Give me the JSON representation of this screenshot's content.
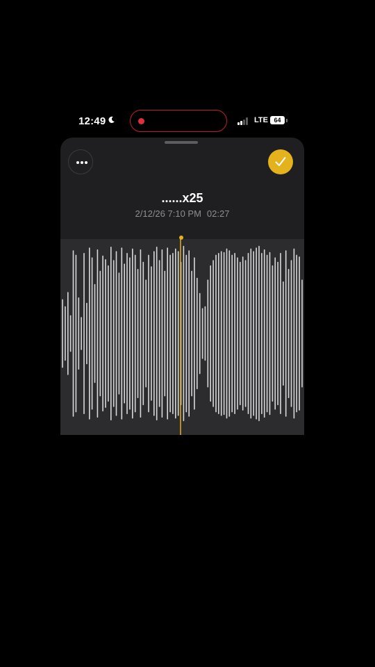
{
  "status_bar": {
    "time": "12:49",
    "network": "LTE",
    "battery": "64",
    "recording_color": "#e0313a"
  },
  "recording": {
    "title": "......x25",
    "date": "2/12/26 7:10 PM",
    "duration": "02:27"
  },
  "colors": {
    "accent": "#e4b21c",
    "sheet_bg": "#1f1f21",
    "waveform_bg": "#2c2c2f",
    "waveform_bars": "#d9d9dc",
    "playhead": "#e4b21c"
  },
  "icons": {
    "more": "ellipsis-icon",
    "done": "checkmark-icon",
    "focus": "moon-icon"
  },
  "waveform_data": {
    "amplitudes": [
      0.38,
      0.3,
      0.46,
      0.2,
      0.93,
      0.88,
      0.4,
      0.18,
      0.9,
      0.34,
      0.96,
      0.85,
      0.55,
      0.94,
      0.7,
      0.87,
      0.83,
      0.76,
      0.97,
      0.82,
      0.92,
      0.68,
      0.96,
      0.78,
      0.9,
      0.85,
      0.95,
      0.88,
      0.72,
      0.94,
      0.8,
      0.6,
      0.88,
      0.75,
      0.92,
      0.97,
      0.82,
      0.94,
      0.7,
      0.96,
      0.88,
      0.9,
      0.95,
      0.92,
      0.8,
      0.98,
      0.88,
      0.93,
      0.7,
      0.85,
      0.62,
      0.45,
      0.28,
      0.3,
      0.6,
      0.76,
      0.82,
      0.88,
      0.9,
      0.92,
      0.91,
      0.95,
      0.93,
      0.88,
      0.9,
      0.85,
      0.8,
      0.86,
      0.82,
      0.9,
      0.95,
      0.92,
      0.96,
      0.98,
      0.9,
      0.94,
      0.88,
      0.91,
      0.76,
      0.85,
      0.8,
      0.9,
      0.58,
      0.93,
      0.72,
      0.82,
      0.95,
      0.88,
      0.86,
      0.6
    ],
    "playhead_fraction": 0.49
  }
}
